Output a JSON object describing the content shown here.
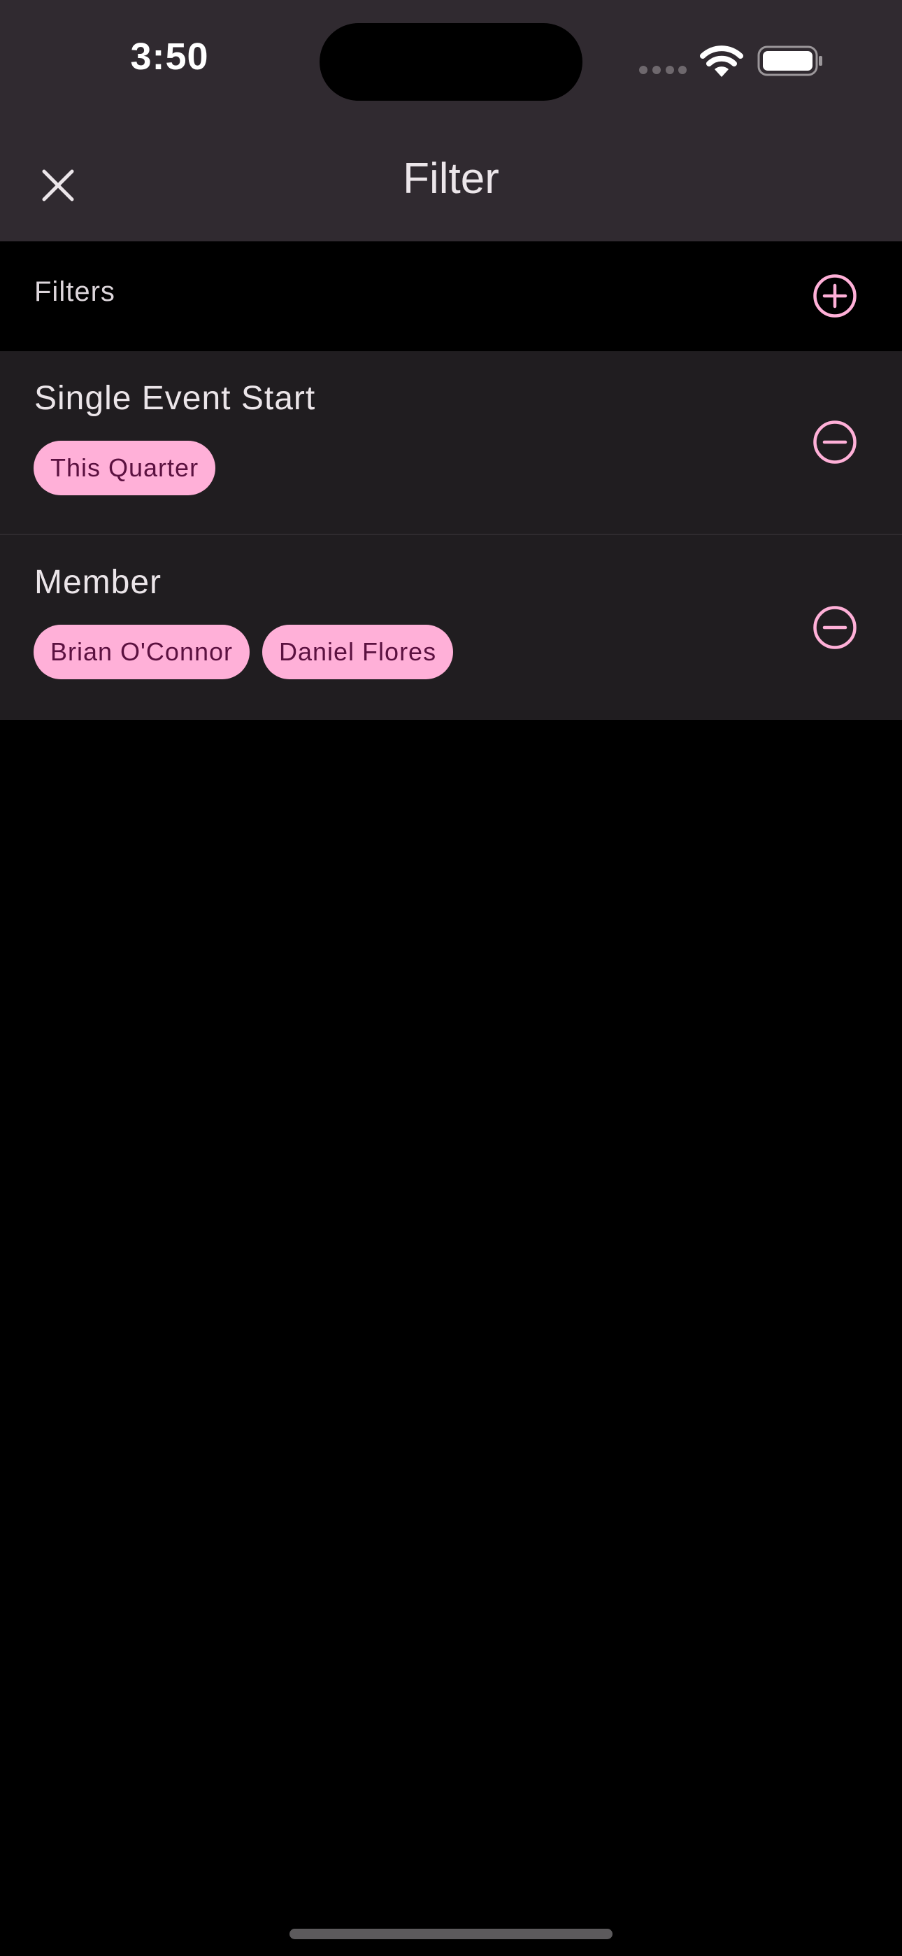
{
  "status_bar": {
    "time": "3:50"
  },
  "header": {
    "title": "Filter",
    "close_icon": "close-icon"
  },
  "filters_section": {
    "label": "Filters",
    "add_icon": "add-circle-icon"
  },
  "filter_items": [
    {
      "label": "Single Event Start",
      "chips": [
        "This Quarter"
      ],
      "remove_icon": "remove-circle-icon"
    },
    {
      "label": "Member",
      "chips": [
        "Brian O'Connor",
        "Daniel Flores"
      ],
      "remove_icon": "remove-circle-icon"
    }
  ],
  "colors": {
    "header_bg": "#302a30",
    "item_bg": "#201d20",
    "accent": "#ffb0d8",
    "chip_text": "#5b1140"
  }
}
